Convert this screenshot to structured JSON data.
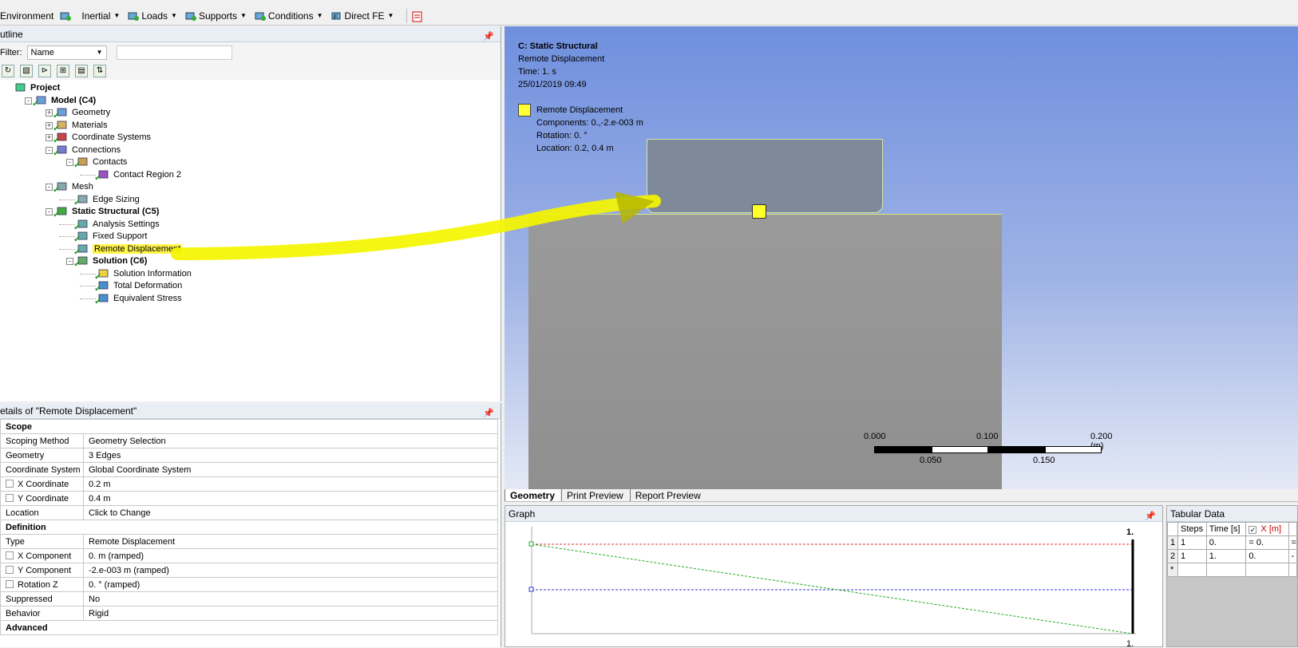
{
  "toolbar": {
    "items": [
      {
        "label": "Environment",
        "icon": "environment-icon"
      },
      {
        "label": "Inertial",
        "icon": "inertial-icon"
      },
      {
        "label": "Loads",
        "icon": "loads-icon"
      },
      {
        "label": "Supports",
        "icon": "supports-icon"
      },
      {
        "label": "Conditions",
        "icon": "conditions-icon"
      },
      {
        "label": "Direct FE",
        "icon": "direct-fe-icon"
      }
    ]
  },
  "outline": {
    "title": "utline",
    "filter_label": "Filter:",
    "filter_value": "Name",
    "filter_text": "",
    "tree": [
      {
        "label": "Project",
        "level": 0,
        "bold": true
      },
      {
        "label": "Model (C4)",
        "level": 1,
        "bold": true
      },
      {
        "label": "Geometry",
        "level": 2
      },
      {
        "label": "Materials",
        "level": 2
      },
      {
        "label": "Coordinate Systems",
        "level": 2
      },
      {
        "label": "Connections",
        "level": 2
      },
      {
        "label": "Contacts",
        "level": 3
      },
      {
        "label": "Contact Region 2",
        "level": 4
      },
      {
        "label": "Mesh",
        "level": 2
      },
      {
        "label": "Edge Sizing",
        "level": 3
      },
      {
        "label": "Static Structural (C5)",
        "level": 2,
        "bold": true
      },
      {
        "label": "Analysis Settings",
        "level": 3
      },
      {
        "label": "Fixed Support",
        "level": 3
      },
      {
        "label": "Remote Displacement",
        "level": 3,
        "selected": true
      },
      {
        "label": "Solution (C6)",
        "level": 3,
        "bold": true
      },
      {
        "label": "Solution Information",
        "level": 4
      },
      {
        "label": "Total Deformation",
        "level": 4
      },
      {
        "label": "Equivalent Stress",
        "level": 4
      }
    ]
  },
  "details": {
    "title": "etails of \"Remote Displacement\"",
    "rows": [
      {
        "section": "Scope"
      },
      {
        "key": "Scoping Method",
        "value": "Geometry Selection"
      },
      {
        "key": "Geometry",
        "value": "3 Edges"
      },
      {
        "key": "Coordinate System",
        "value": "Global Coordinate System"
      },
      {
        "key": "X Coordinate",
        "value": "0.2 m",
        "checkbox": true
      },
      {
        "key": "Y Coordinate",
        "value": "0.4 m",
        "checkbox": true
      },
      {
        "key": "Location",
        "value": "Click to Change"
      },
      {
        "section": "Definition"
      },
      {
        "key": "Type",
        "value": "Remote Displacement"
      },
      {
        "key": "X Component",
        "value": "0. m  (ramped)",
        "checkbox": true
      },
      {
        "key": "Y Component",
        "value": "-2.e-003 m  (ramped)",
        "checkbox": true
      },
      {
        "key": "Rotation Z",
        "value": "0. °  (ramped)",
        "checkbox": true
      },
      {
        "key": "Suppressed",
        "value": "No"
      },
      {
        "key": "Behavior",
        "value": "Rigid"
      },
      {
        "section": "Advanced"
      }
    ]
  },
  "viewport": {
    "analysis": "C: Static Structural",
    "object": "Remote Displacement",
    "time": "Time: 1. s",
    "date": "25/01/2019 09:49",
    "legend_title": "Remote Displacement",
    "legend_lines": [
      "Components: 0.,-2.e-003 m",
      "Rotation: 0. °",
      "Location: 0.2, 0.4 m"
    ],
    "scale": {
      "top": [
        "0.000",
        "0.100",
        "0.200 (m)"
      ],
      "bottom": [
        "0.050",
        "0.150"
      ]
    }
  },
  "tabs": [
    "Geometry",
    "Print Preview",
    "Report Preview"
  ],
  "graph": {
    "title": "Graph",
    "top_label": "1.",
    "bottom_label": "1."
  },
  "tabular": {
    "title": "Tabular Data",
    "headers": [
      "",
      "Steps",
      "Time [s]",
      "X [m]",
      ""
    ],
    "rows": [
      [
        "1",
        "1",
        "0.",
        "= 0.",
        "="
      ],
      [
        "2",
        "1",
        "1.",
        "0.",
        "-"
      ],
      [
        "*",
        "",
        "",
        "",
        ""
      ]
    ]
  },
  "colors": {
    "highlight": "#fff44a",
    "legend": "#ffff33",
    "annotation": "#f5f500"
  }
}
